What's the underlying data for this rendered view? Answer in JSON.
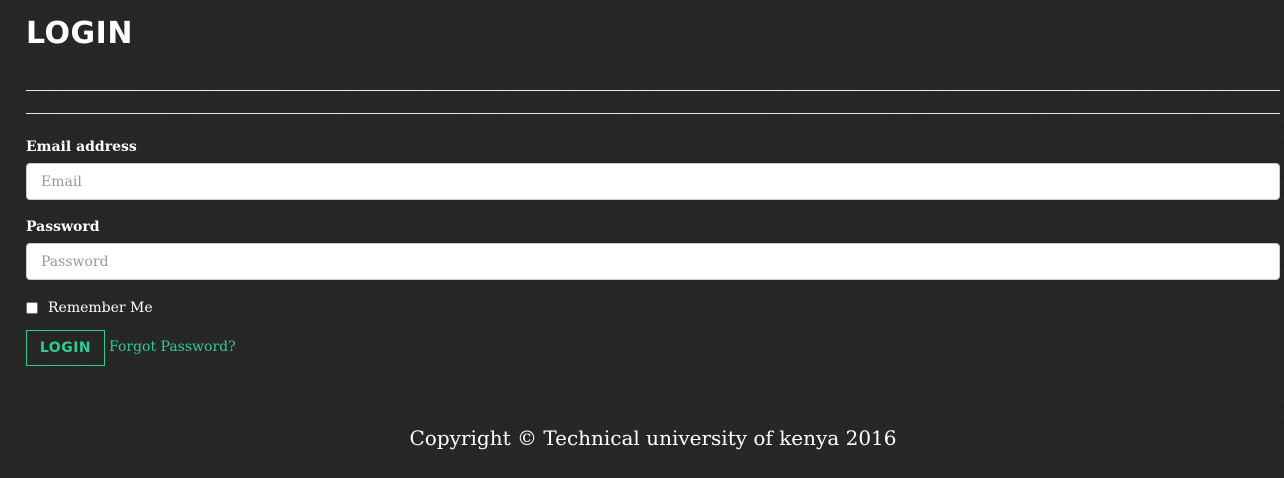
{
  "header": {
    "title": "LOGIN"
  },
  "form": {
    "email": {
      "label": "Email address",
      "placeholder": "Email",
      "value": ""
    },
    "password": {
      "label": "Password",
      "placeholder": "Password",
      "value": ""
    },
    "remember": {
      "label": "Remember Me",
      "checked": false
    },
    "submit_label": "LOGIN",
    "forgot_label": "Forgot Password?"
  },
  "footer": {
    "copyright": "Copyright © Technical university of kenya 2016"
  },
  "colors": {
    "background": "#262626",
    "accent": "#2ecc8f",
    "text": "#ffffff"
  }
}
